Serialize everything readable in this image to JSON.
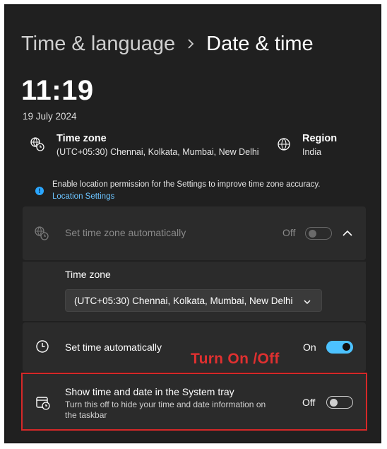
{
  "breadcrumb": {
    "parent": "Time & language",
    "separator": "›",
    "current": "Date & time"
  },
  "clock": {
    "time": "11:19",
    "date": "19 July 2024"
  },
  "time_zone_info": {
    "label": "Time zone",
    "value": "(UTC+05:30) Chennai, Kolkata, Mumbai, New Delhi"
  },
  "region_info": {
    "label": "Region",
    "value": "India"
  },
  "notice": {
    "text": "Enable location permission for the Settings to improve time zone accuracy.",
    "link": "Location Settings"
  },
  "auto_time_zone": {
    "label": "Set time zone automatically",
    "state_label": "Off",
    "on": false,
    "disabled": true
  },
  "time_zone_select": {
    "label": "Time zone",
    "value": "(UTC+05:30) Chennai, Kolkata, Mumbai, New Delhi"
  },
  "auto_time": {
    "label": "Set time automatically",
    "state_label": "On",
    "on": true
  },
  "system_tray": {
    "label": "Show time and date in the System tray",
    "description_line1": "Turn this off to hide your time and date information on",
    "description_line2": "the taskbar",
    "state_label": "Off",
    "on": false
  },
  "annotation": {
    "text": "Turn On /Off"
  },
  "colors": {
    "background": "#202020",
    "card": "#2b2b2b",
    "accent": "#4cc2ff",
    "link": "#6cc4ff",
    "annotation": "#e03030"
  },
  "icons": [
    "chevron-right-icon",
    "globe-clock-icon",
    "globe-icon",
    "info-icon",
    "chevron-up-icon",
    "chevron-down-icon",
    "clock-icon",
    "calendar-clock-icon"
  ]
}
